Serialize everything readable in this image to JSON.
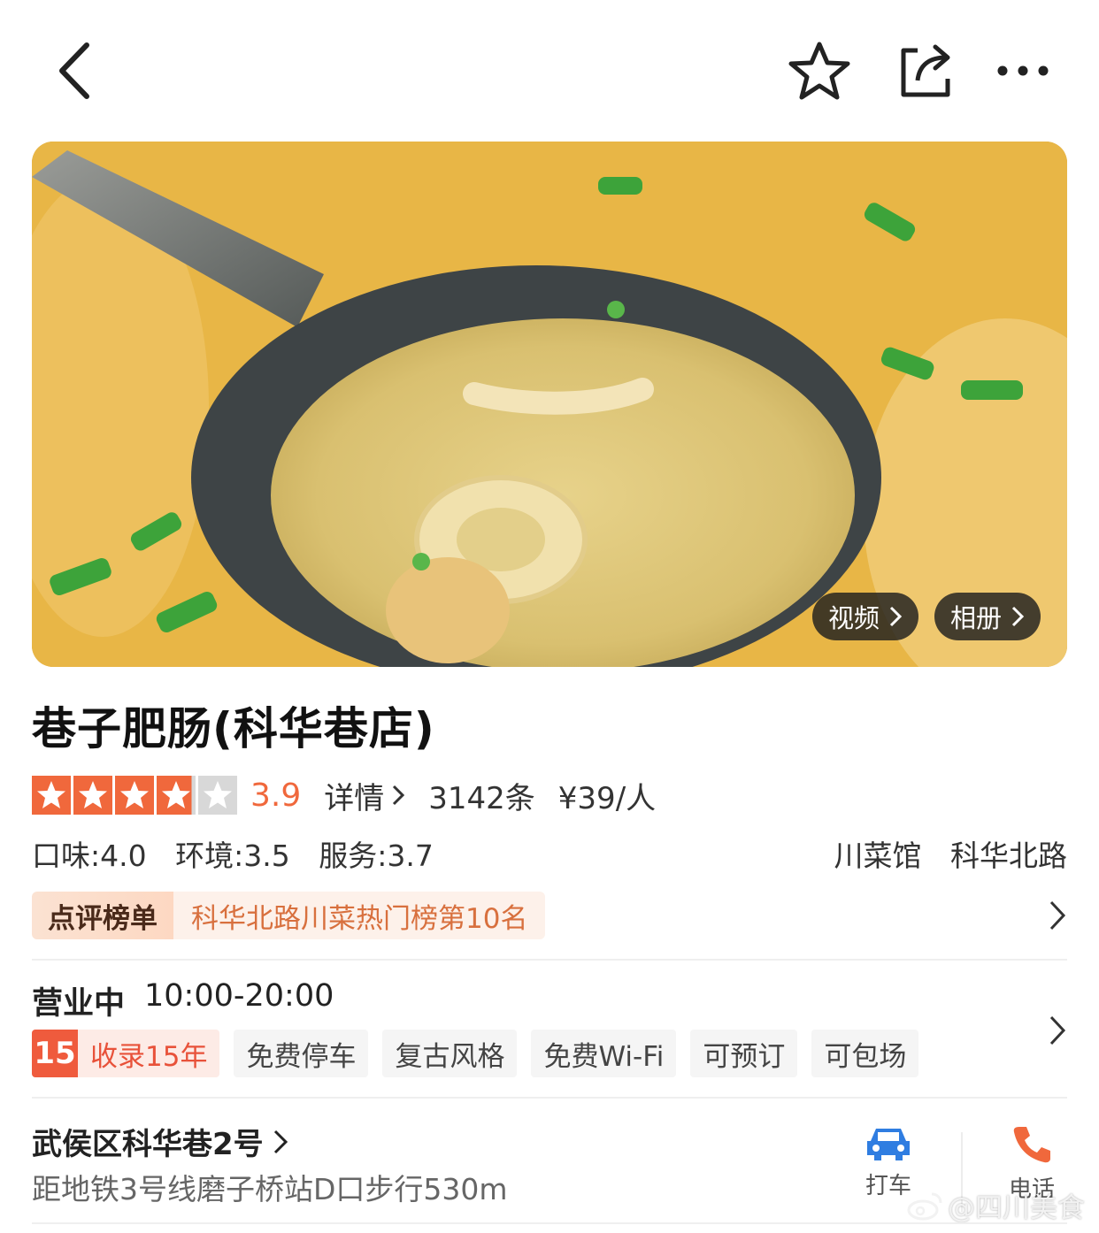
{
  "hero": {
    "video_label": "视频",
    "album_label": "相册"
  },
  "shop": {
    "name": "巷子肥肠(科华巷店)",
    "rating": 3.9,
    "rating_text": "3.9",
    "details_label": "详情",
    "review_count": "3142条",
    "price_per_person": "¥39/人",
    "scores": {
      "taste": "口味:4.0",
      "environment": "环境:3.5",
      "service": "服务:3.7"
    },
    "category": "川菜馆",
    "area": "科华北路"
  },
  "ranking": {
    "label": "点评榜单",
    "text": "科华北路川菜热门榜第10名"
  },
  "hours": {
    "status": "营业中",
    "time": "10:00-20:00"
  },
  "tags": {
    "years_badge": "15",
    "years_label": "收录15年",
    "items": [
      "免费停车",
      "复古风格",
      "免费Wi-Fi",
      "可预订",
      "可包场"
    ]
  },
  "address": {
    "street": "武侯区科华巷2号",
    "distance": "距地铁3号线磨子桥站D口步行530m"
  },
  "actions": {
    "taxi_label": "打车",
    "phone_label": "电话"
  },
  "watermark": "@四川美食",
  "colors": {
    "accent": "#f0683c",
    "star_on": "#f0683c",
    "star_off": "#d8d8d8",
    "rank_text": "#d8703e",
    "taxi_icon": "#2f7de1",
    "phone_icon": "#f0683c"
  },
  "icons": [
    "back-arrow-icon",
    "star-outline-icon",
    "share-icon",
    "more-dots-icon",
    "chevron-right-icon",
    "car-icon",
    "phone-icon",
    "weibo-icon"
  ]
}
